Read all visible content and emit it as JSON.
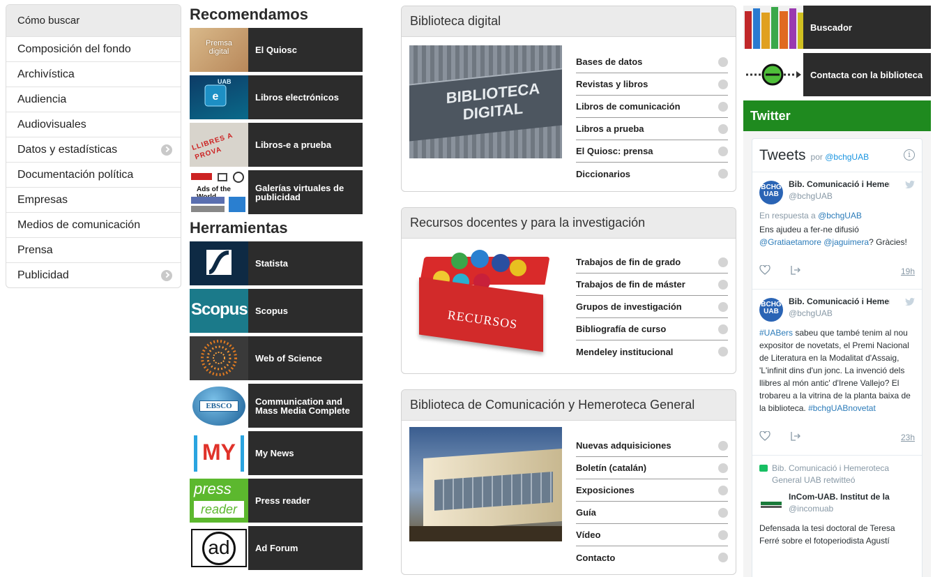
{
  "left_nav": {
    "items": [
      {
        "label": "Cómo buscar",
        "expandable": false
      },
      {
        "label": "Composición del fondo",
        "expandable": false
      },
      {
        "label": "Archivística",
        "expandable": false
      },
      {
        "label": "Audiencia",
        "expandable": false
      },
      {
        "label": "Audiovisuales",
        "expandable": false
      },
      {
        "label": "Datos y estadísticas",
        "expandable": true
      },
      {
        "label": "Documentación política",
        "expandable": false
      },
      {
        "label": "Empresas",
        "expandable": false
      },
      {
        "label": "Medios de comunicación",
        "expandable": false
      },
      {
        "label": "Prensa",
        "expandable": false
      },
      {
        "label": "Publicidad",
        "expandable": true
      }
    ]
  },
  "recomendamos": {
    "heading": "Recomendamos",
    "tiles": [
      {
        "label": "El Quiosc",
        "thumb_text": "Premsa digital"
      },
      {
        "label": "Libros electrónicos",
        "thumb_text": "UAB"
      },
      {
        "label": "Libros-e a prueba",
        "thumb_text": "LLIBRES A PROVA"
      },
      {
        "label": "Galerías virtuales de publicidad",
        "thumb_text": "Ads of the World"
      }
    ]
  },
  "herramientas": {
    "heading": "Herramientas",
    "tiles": [
      {
        "label": "Statista",
        "thumb_text": ""
      },
      {
        "label": "Scopus",
        "thumb_text": "Scopus"
      },
      {
        "label": "Web of Science",
        "thumb_text": ""
      },
      {
        "label": "Communication and Mass Media Complete",
        "thumb_text": "EBSCO"
      },
      {
        "label": "My News",
        "thumb_text": "MY"
      },
      {
        "label": "Press reader",
        "thumb_text_1": "press",
        "thumb_text_2": "reader"
      },
      {
        "label": "Ad Forum",
        "thumb_text": "ad"
      }
    ]
  },
  "panels": [
    {
      "title": "Biblioteca digital",
      "image_caption": "BIBLIOTECA DIGITAL",
      "links": [
        "Bases de datos",
        "Revistas y libros",
        "Libros de comunicación",
        "Libros a prueba",
        "El Quiosc: prensa",
        "Diccionarios"
      ]
    },
    {
      "title": "Recursos docentes y para la investigación",
      "image_caption": "RECURSOS",
      "links": [
        "Trabajos de fin de grado",
        "Trabajos de fin de máster",
        "Grupos de investigación",
        "Bibliografía de curso",
        "Mendeley institucional"
      ]
    },
    {
      "title": "Biblioteca de Comunicación y Hemeroteca General",
      "links": [
        "Nuevas adquisiciones",
        "Boletín (catalán)",
        "Exposiciones",
        "Guía",
        "Vídeo",
        "Contacto"
      ]
    }
  ],
  "right_tiles": [
    {
      "label": "Buscador"
    },
    {
      "label": "Contacta con la biblioteca"
    }
  ],
  "twitter": {
    "bar_label": "Twitter",
    "title": "Tweets",
    "by_prefix": "por",
    "by_handle": "@bchgUAB",
    "tweets": [
      {
        "avatar_text_1": "BCHG",
        "avatar_text_2": "UAB",
        "name": "Bib. Comunicació i Hemeroteca General UAB",
        "handle": "@bchgUAB",
        "reply_prefix": "En respuesta a",
        "reply_to": "@bchgUAB",
        "text_1": "Ens ajudeu a fer-ne difusió",
        "link_1": "@Gratiaetamore",
        "link_2": "@jaguimera",
        "text_2": "? Gràcies!",
        "time": "19h"
      },
      {
        "avatar_text_1": "BCHG",
        "avatar_text_2": "UAB",
        "name": "Bib. Comunicació i Hemeroteca General UAB",
        "handle": "@bchgUAB",
        "hashtag_1": "#UABers",
        "text": "sabeu que també tenim al nou expositor de novetats, el Premi Nacional de Literatura en la Modalitat d'Assaig, 'L'infinit dins d'un jonc. La invenció dels llibres al món antic' d'Irene Vallejo? El trobareu a la vitrina de la planta baixa de la biblioteca.",
        "hashtag_2": "#bchgUABnovetat",
        "time": "23h"
      }
    ],
    "retweet": {
      "rt_by": "Bib. Comunicació i Hemeroteca General UAB retwitteó",
      "name": "InCom-UAB. Institut de la Comunicació",
      "handle": "@incomuab",
      "text": "Defensada la tesi doctoral de Teresa Ferré sobre el fotoperiodista Agustí"
    }
  }
}
